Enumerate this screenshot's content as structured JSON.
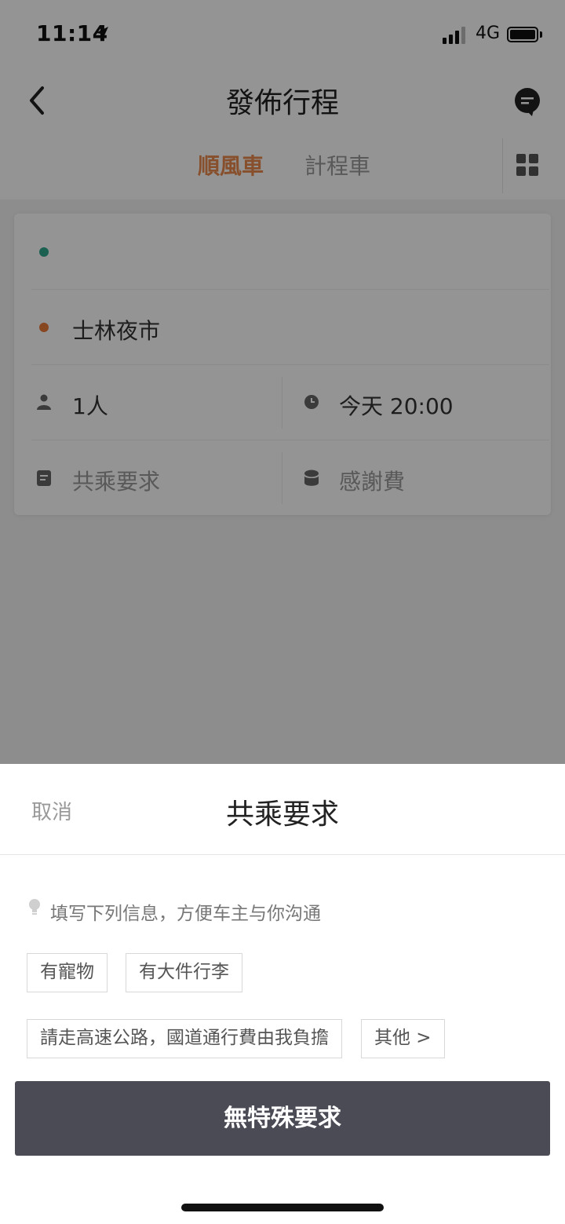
{
  "status_bar": {
    "time": "11:14",
    "network": "4G"
  },
  "header": {
    "title": "發佈行程"
  },
  "tabs": [
    {
      "label": "順風車",
      "active": true
    },
    {
      "label": "計程車",
      "active": false
    }
  ],
  "trip": {
    "origin": "",
    "destination": "士林夜市",
    "passengers": "1人",
    "time": "今天 20:00",
    "requirements_placeholder": "共乘要求",
    "tip_placeholder": "感謝費"
  },
  "sheet": {
    "cancel_label": "取消",
    "title": "共乘要求",
    "hint": "填写下列信息，方便车主与你沟通",
    "options": [
      "有寵物",
      "有大件行李",
      "請走高速公路，國道通行費由我負擔",
      "其他 >"
    ],
    "submit_label": "無特殊要求"
  },
  "colors": {
    "accent": "#e9894a",
    "origin_dot": "#2fa58a",
    "destination_dot": "#e87a3a",
    "button": "#4b4b56"
  },
  "icons": [
    "back-icon",
    "location-arrow-icon",
    "signal-icon",
    "battery-icon",
    "chat-icon",
    "grid-icon",
    "person-icon",
    "clock-icon",
    "note-icon",
    "wallet-icon",
    "lightbulb-icon"
  ]
}
